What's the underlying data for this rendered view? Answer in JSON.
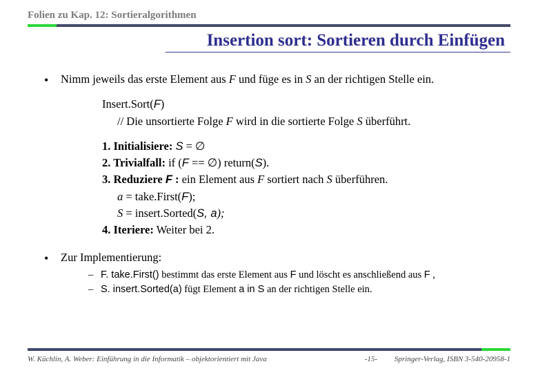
{
  "header": {
    "chapter": "Folien zu Kap. 12: Sortieralgorithmen",
    "title": "Insertion sort:  Sortieren durch Einfügen"
  },
  "bullet1": {
    "pre": "Nimm jeweils das erste Element aus ",
    "F": "F",
    "mid": " und füge es in ",
    "S": "S",
    "post": " an der richtigen Stelle ein."
  },
  "algo": {
    "head_pre": "Insert.Sort(",
    "head_F": "F",
    "head_post": ")",
    "comment_pre": "// Die unsortierte Folge ",
    "comment_F": "F",
    "comment_mid": " wird in die sortierte Folge ",
    "comment_S": "S",
    "comment_post": " überführt.",
    "s1_label": "1. Initialisiere:",
    "s1_body_pre": " ",
    "s1_S": "S",
    "s1_eq": " = ∅",
    "s2_label": "2. Trivialfall:",
    "s2_if": " if (",
    "s2_F": "F",
    "s2_eqempty": " == ∅",
    "s2_ret_pre": ") return(",
    "s2_S": "S",
    "s2_ret_post": ").",
    "s3_label": "3. Reduziere ",
    "s3_F": "F",
    "s3_colon": " :",
    "s3_body_pre": " ein Element aus ",
    "s3_F2": "F",
    "s3_body_mid": " sortiert nach ",
    "s3_S": "S",
    "s3_body_post": " überführen.",
    "s3a_a": "a",
    "s3a_eq": " = take.First(",
    "s3a_F": "F",
    "s3a_post": ");",
    "s3b_S": "S",
    "s3b_eq": " = insert.Sorted(",
    "s3b_args": "S, a",
    "s3b_post": ");",
    "s4_label": "4. Iteriere:",
    "s4_body": " Weiter bei 2."
  },
  "impl": {
    "heading": "Zur Implementierung:",
    "d1_pre": "F. take.First()",
    "d1_mid": " bestimmt das erste Element aus ",
    "d1_F": "F",
    "d1_mid2": " und löscht es anschließend aus ",
    "d1_F2": "F",
    "d1_post": " ,",
    "d2_pre": "S. insert.Sorted(a)",
    "d2_mid": "  fügt Element  ",
    "d2_ains": "a  in  S",
    "d2_post": "  an der richtigen Stelle ein."
  },
  "footer": {
    "left": "W. Küchlin, A. Weber: Einführung in die Informatik – objektorientiert mit Java",
    "page": "-15-",
    "right": "Springer-Verlag, ISBN 3-540-20958-1"
  }
}
